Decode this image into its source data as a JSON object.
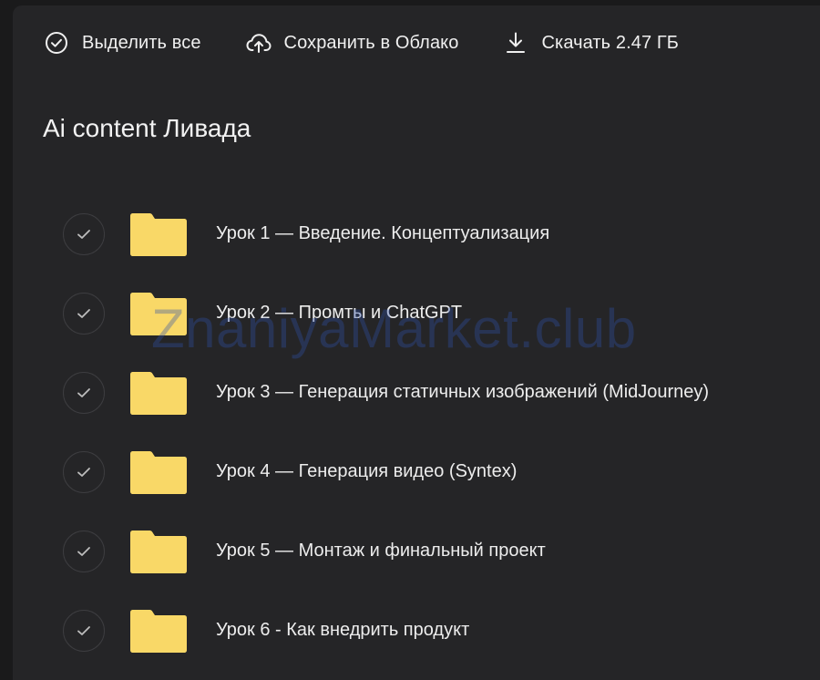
{
  "toolbar": {
    "select_all": {
      "label": "Выделить все",
      "icon": "check-circle-icon"
    },
    "save_cloud": {
      "label": "Сохранить в Облако",
      "icon": "cloud-upload-icon"
    },
    "download": {
      "label": "Скачать 2.47 ГБ",
      "icon": "download-icon"
    }
  },
  "folder_title": "Ai content Ливада",
  "items": [
    {
      "label": "Урок 1 — Введение. Концептуализация",
      "icon": "folder-icon"
    },
    {
      "label": "Урок 2 — Промты и ChatGPT",
      "icon": "folder-icon"
    },
    {
      "label": "Урок 3 — Генерация статичных изображений (MidJourney)",
      "icon": "folder-icon"
    },
    {
      "label": "Урок 4 — Генерация видео (Syntex)",
      "icon": "folder-icon"
    },
    {
      "label": "Урок 5 — Монтаж и финальный проект",
      "icon": "folder-icon"
    },
    {
      "label": "Урок 6 - Как внедрить продукт",
      "icon": "folder-icon"
    }
  ],
  "watermark": "ZnaniyaMarket.club",
  "colors": {
    "background": "#1a1a1b",
    "panel": "#252527",
    "text": "#ececec",
    "folder": "#f9d867",
    "check_border": "#3d3d40",
    "watermark": "#2d50aa"
  }
}
